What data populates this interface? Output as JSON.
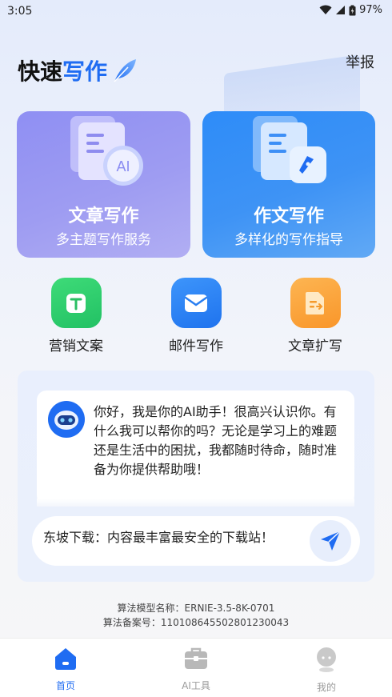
{
  "status_bar": {
    "time": "3:05",
    "battery": "97%"
  },
  "header": {
    "brand_main": "快速",
    "brand_accent": "写作",
    "report_label": "举报"
  },
  "cards": [
    {
      "title": "文章写作",
      "subtitle": "多主题写作服务",
      "illus_label": "AI"
    },
    {
      "title": "作文写作",
      "subtitle": "多样化的写作指导"
    }
  ],
  "quick_actions": [
    {
      "label": "营销文案",
      "icon": "text-t-icon",
      "color": "#2ecf6e"
    },
    {
      "label": "邮件写作",
      "icon": "mail-envelope-icon",
      "color": "#2a84f5"
    },
    {
      "label": "文章扩写",
      "icon": "document-expand-icon",
      "color": "#fba43a"
    }
  ],
  "chat": {
    "assistant_message": "你好，我是你的AI助手！很高兴认识你。有什么我可以帮你的吗？无论是学习上的难题还是生活中的困扰，我都随时待命，随时准备为你提供帮助哦！",
    "input_value": "东坡下载：内容最丰富最安全的下载站！"
  },
  "algorithm": {
    "model_name": "算法模型名称：ERNIE-3.5-8K-0701",
    "record_number": "算法备案号：110108645502801230043"
  },
  "bottom_nav": [
    {
      "label": "首页",
      "active": true
    },
    {
      "label": "AI工具",
      "active": false
    },
    {
      "label": "我的",
      "active": false
    }
  ],
  "colors": {
    "accent": "#1f6cf2",
    "nav_active": "#1f6cf2",
    "nav_inactive": "#9a9a9a"
  }
}
